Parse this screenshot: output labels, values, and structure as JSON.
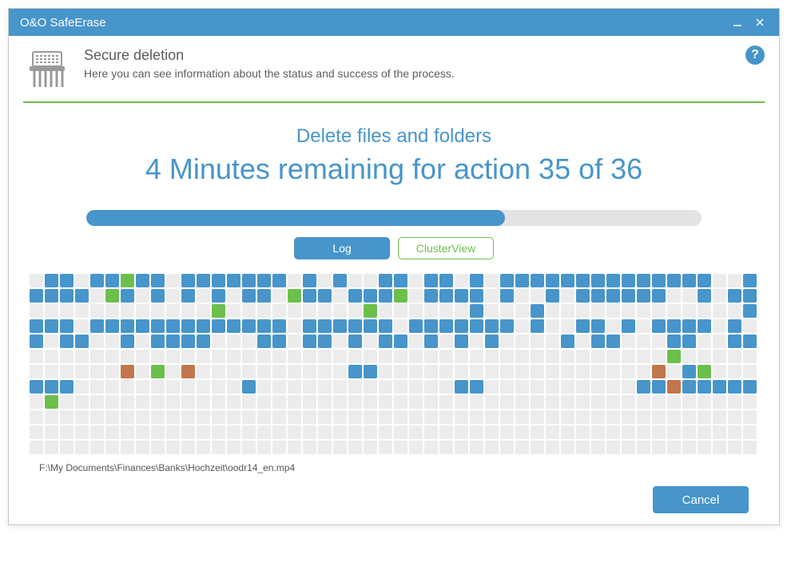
{
  "window": {
    "title": "O&O SafeErase"
  },
  "header": {
    "title": "Secure deletion",
    "subtitle": "Here you can see information about the status and success of the process."
  },
  "status": {
    "line1": "Delete files and folders",
    "line2": "4 Minutes remaining for action 35 of 36",
    "progress_percent": 68
  },
  "tabs": {
    "log": "Log",
    "cluster": "ClusterView",
    "active": "cluster"
  },
  "cluster": {
    "cols": 48,
    "rows": 12,
    "legend": {
      "e": "empty",
      "b": "blue",
      "g": "green",
      "o": "orange"
    },
    "cells": [
      "e",
      "b",
      "b",
      "e",
      "b",
      "b",
      "g",
      "b",
      "b",
      "e",
      "b",
      "b",
      "b",
      "b",
      "b",
      "b",
      "b",
      "e",
      "b",
      "e",
      "b",
      "e",
      "e",
      "b",
      "b",
      "e",
      "b",
      "b",
      "e",
      "b",
      "e",
      "b",
      "b",
      "b",
      "b",
      "b",
      "b",
      "b",
      "b",
      "b",
      "b",
      "b",
      "b",
      "b",
      "b",
      "e",
      "e",
      "b",
      "b",
      "b",
      "b",
      "b",
      "e",
      "g",
      "b",
      "e",
      "b",
      "e",
      "b",
      "e",
      "b",
      "e",
      "b",
      "b",
      "e",
      "g",
      "b",
      "b",
      "e",
      "b",
      "b",
      "b",
      "g",
      "e",
      "b",
      "b",
      "b",
      "b",
      "e",
      "b",
      "e",
      "e",
      "b",
      "e",
      "b",
      "b",
      "b",
      "b",
      "b",
      "b",
      "e",
      "e",
      "b",
      "e",
      "b",
      "b",
      "e",
      "e",
      "e",
      "e",
      "e",
      "e",
      "e",
      "e",
      "e",
      "e",
      "e",
      "e",
      "g",
      "e",
      "e",
      "e",
      "e",
      "e",
      "e",
      "e",
      "e",
      "e",
      "g",
      "e",
      "e",
      "e",
      "e",
      "e",
      "e",
      "b",
      "e",
      "e",
      "e",
      "b",
      "e",
      "e",
      "e",
      "e",
      "e",
      "e",
      "e",
      "e",
      "e",
      "e",
      "e",
      "e",
      "e",
      "b",
      "b",
      "b",
      "b",
      "e",
      "b",
      "b",
      "b",
      "b",
      "b",
      "b",
      "b",
      "b",
      "b",
      "b",
      "b",
      "b",
      "b",
      "e",
      "b",
      "b",
      "b",
      "b",
      "b",
      "b",
      "e",
      "b",
      "b",
      "b",
      "b",
      "b",
      "b",
      "b",
      "e",
      "b",
      "e",
      "e",
      "b",
      "b",
      "e",
      "b",
      "e",
      "b",
      "b",
      "b",
      "b",
      "e",
      "b",
      "e",
      "b",
      "e",
      "b",
      "b",
      "e",
      "e",
      "b",
      "e",
      "b",
      "b",
      "b",
      "b",
      "e",
      "e",
      "e",
      "b",
      "b",
      "e",
      "b",
      "b",
      "e",
      "b",
      "e",
      "b",
      "b",
      "e",
      "b",
      "e",
      "b",
      "e",
      "b",
      "e",
      "e",
      "e",
      "e",
      "b",
      "e",
      "b",
      "b",
      "e",
      "e",
      "e",
      "b",
      "b",
      "e",
      "e",
      "b",
      "b",
      "e",
      "e",
      "e",
      "e",
      "e",
      "e",
      "e",
      "e",
      "e",
      "e",
      "e",
      "e",
      "e",
      "e",
      "e",
      "e",
      "e",
      "e",
      "e",
      "e",
      "e",
      "e",
      "e",
      "e",
      "e",
      "e",
      "e",
      "e",
      "e",
      "e",
      "e",
      "e",
      "e",
      "e",
      "e",
      "e",
      "e",
      "e",
      "e",
      "e",
      "e",
      "e",
      "g",
      "e",
      "e",
      "e",
      "e",
      "e",
      "e",
      "e",
      "e",
      "e",
      "e",
      "e",
      "o",
      "e",
      "g",
      "e",
      "o",
      "e",
      "e",
      "e",
      "e",
      "e",
      "e",
      "e",
      "e",
      "e",
      "e",
      "b",
      "b",
      "e",
      "e",
      "e",
      "e",
      "e",
      "e",
      "e",
      "e",
      "e",
      "e",
      "e",
      "e",
      "e",
      "e",
      "e",
      "e",
      "e",
      "e",
      "o",
      "e",
      "b",
      "g",
      "e",
      "e",
      "e",
      "b",
      "b",
      "b",
      "e",
      "e",
      "e",
      "e",
      "e",
      "e",
      "e",
      "e",
      "e",
      "e",
      "e",
      "b",
      "e",
      "e",
      "e",
      "e",
      "e",
      "e",
      "e",
      "e",
      "e",
      "e",
      "e",
      "e",
      "e",
      "b",
      "b",
      "e",
      "e",
      "e",
      "e",
      "e",
      "e",
      "e",
      "e",
      "e",
      "e",
      "b",
      "b",
      "o",
      "b",
      "b",
      "b",
      "b",
      "b",
      "e",
      "g",
      "e",
      "e",
      "e",
      "e",
      "e",
      "e",
      "e",
      "e",
      "e",
      "e",
      "e",
      "e",
      "e",
      "e",
      "e",
      "e",
      "e",
      "e",
      "e",
      "e",
      "e",
      "e",
      "e",
      "e",
      "e",
      "e",
      "e",
      "e",
      "e",
      "e",
      "e",
      "e",
      "e",
      "e",
      "e",
      "e",
      "e",
      "e",
      "e",
      "e",
      "e",
      "e",
      "e",
      "e",
      "e",
      "e",
      "e",
      "e",
      "e",
      "e",
      "e",
      "e",
      "e",
      "e",
      "e",
      "e",
      "e",
      "e",
      "e",
      "e",
      "e",
      "e",
      "e",
      "e",
      "e",
      "e",
      "e",
      "e",
      "e",
      "e",
      "e",
      "e",
      "e",
      "e",
      "e",
      "e",
      "e",
      "e",
      "e",
      "e",
      "e",
      "e",
      "e",
      "e",
      "e",
      "e",
      "e",
      "e",
      "e",
      "e",
      "e",
      "e",
      "e",
      "e",
      "e",
      "e",
      "e",
      "e",
      "e",
      "e",
      "e",
      "e",
      "e",
      "e",
      "e",
      "e",
      "e",
      "e",
      "e",
      "e",
      "e",
      "e",
      "e",
      "e",
      "e",
      "e",
      "e",
      "e",
      "e",
      "e",
      "e",
      "e",
      "e",
      "e",
      "e",
      "e",
      "e",
      "e",
      "e",
      "e",
      "e",
      "e",
      "e",
      "e",
      "e",
      "e",
      "e",
      "e",
      "e",
      "e",
      "e",
      "e",
      "e",
      "e",
      "e",
      "e",
      "e",
      "e",
      "e",
      "e",
      "e",
      "e",
      "e",
      "e",
      "e",
      "e",
      "e",
      "e",
      "e",
      "e",
      "e",
      "e",
      "e",
      "e",
      "e",
      "e",
      "e",
      "e",
      "e",
      "e",
      "e",
      "e",
      "e",
      "e",
      "e",
      "e",
      "e",
      "e",
      "e",
      "e",
      "e",
      "e",
      "e",
      "e",
      "e",
      "e",
      "e",
      "e",
      "e",
      "e"
    ]
  },
  "current_file": "F:\\My Documents\\Finances\\Banks\\Hochzeit\\oodr14_en.mp4",
  "footer": {
    "cancel": "Cancel"
  }
}
